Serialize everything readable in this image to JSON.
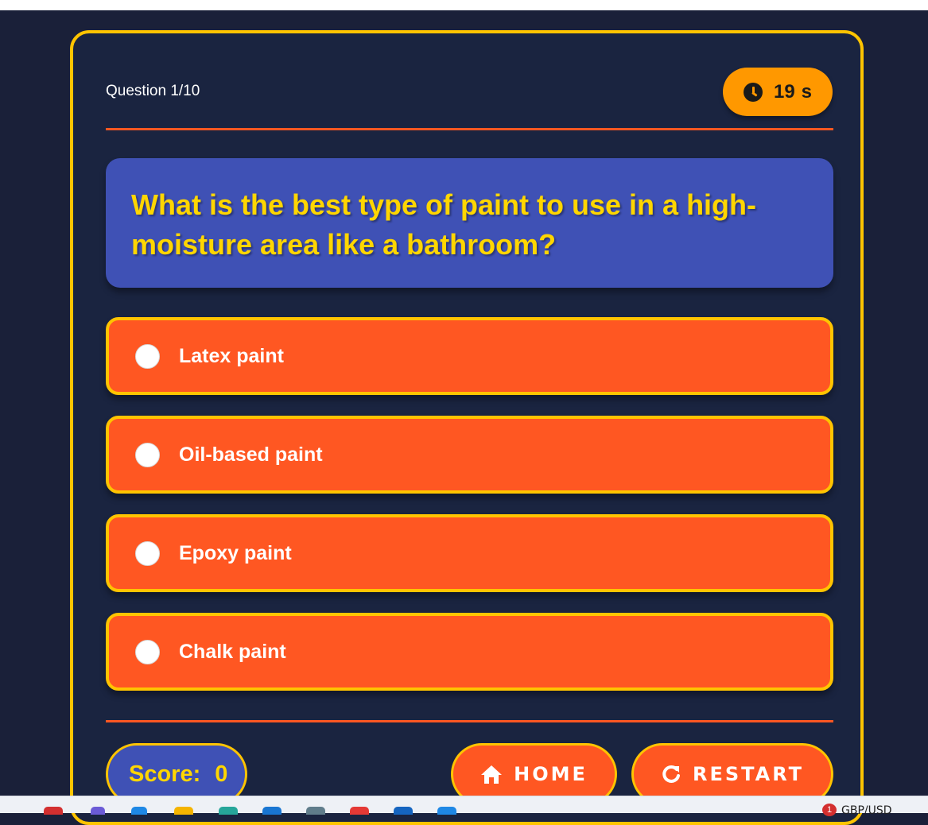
{
  "quiz": {
    "question_counter": "Question 1/10",
    "timer_value": "19",
    "timer_unit": "s",
    "question_text": "What is the best type of paint to use in a high-moisture area like a bathroom?",
    "options": [
      {
        "label": "Latex paint"
      },
      {
        "label": "Oil-based paint"
      },
      {
        "label": "Epoxy paint"
      },
      {
        "label": "Chalk paint"
      }
    ],
    "score_label": "Score:",
    "score_value": "0",
    "home_label": "HOME",
    "restart_label": "RESTART"
  },
  "taskbar": {
    "badge_count": "1",
    "ticker_text": "GBP/USD"
  },
  "colors": {
    "background": "#1a2039",
    "card_border": "#ffc400",
    "accent_orange": "#ff5722",
    "question_bg": "#3f51b5",
    "question_text": "#ffd600",
    "timer_bg": "#ff9800"
  }
}
